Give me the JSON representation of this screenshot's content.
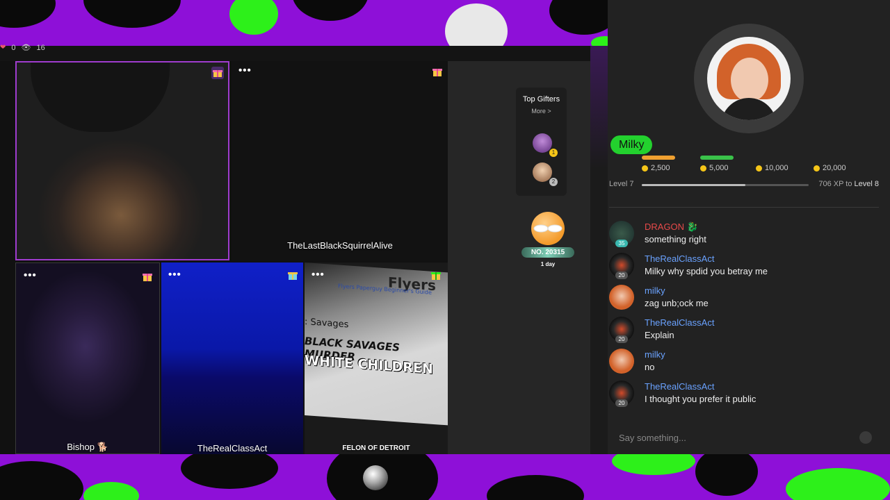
{
  "stats": {
    "likes": "0",
    "viewers": "16"
  },
  "tiles": [
    {
      "name": ""
    },
    {
      "name": "TheLastBlackSquirrelAlive"
    },
    {
      "name": "Bishop 🐕"
    },
    {
      "name": "TheRealClassAct"
    },
    {
      "name": "FELON OF DETROIT"
    }
  ],
  "screen_text": {
    "line1": "Flyers",
    "line2": "Flyers   Paperguy Beginner's Guide",
    "line3": ": Savages",
    "line4": "BLACK SAVAGES MURDER",
    "line5": "WHITE CHILDREN"
  },
  "top_gifters": {
    "title": "Top Gifters",
    "more": "More >",
    "badge1": "1",
    "badge2": "2"
  },
  "rank": {
    "number": "NO. 20315",
    "period": "1 day"
  },
  "host": {
    "name": "Milky"
  },
  "tiers": [
    "2,500",
    "5,000",
    "10,000",
    "20,000"
  ],
  "level": {
    "current": "Level 7",
    "xp_prefix": "706 XP to ",
    "next": "Level 8",
    "progress": 0.62
  },
  "chat": [
    {
      "user": "DRAGON 🐉",
      "level": "35",
      "text": "something right",
      "color": "#e84a4a"
    },
    {
      "user": "TheRealClassAct",
      "level": "20",
      "text": "Milky why spdid you betray me",
      "color": "#6aa2ff"
    },
    {
      "user": "milky",
      "level": "",
      "text": "zag unb;ock me",
      "color": "#6aa2ff"
    },
    {
      "user": "TheRealClassAct",
      "level": "20",
      "text": "Explain",
      "color": "#6aa2ff"
    },
    {
      "user": "milky",
      "level": "",
      "text": "no",
      "color": "#6aa2ff"
    },
    {
      "user": "TheRealClassAct",
      "level": "20",
      "text": "I thought you prefer it public",
      "color": "#6aa2ff"
    }
  ],
  "input": {
    "placeholder": "Say something..."
  },
  "colors": {
    "accent_green": "#23d12e",
    "tile_border": "#a03ccf",
    "chat_user": "#6aa2ff"
  }
}
